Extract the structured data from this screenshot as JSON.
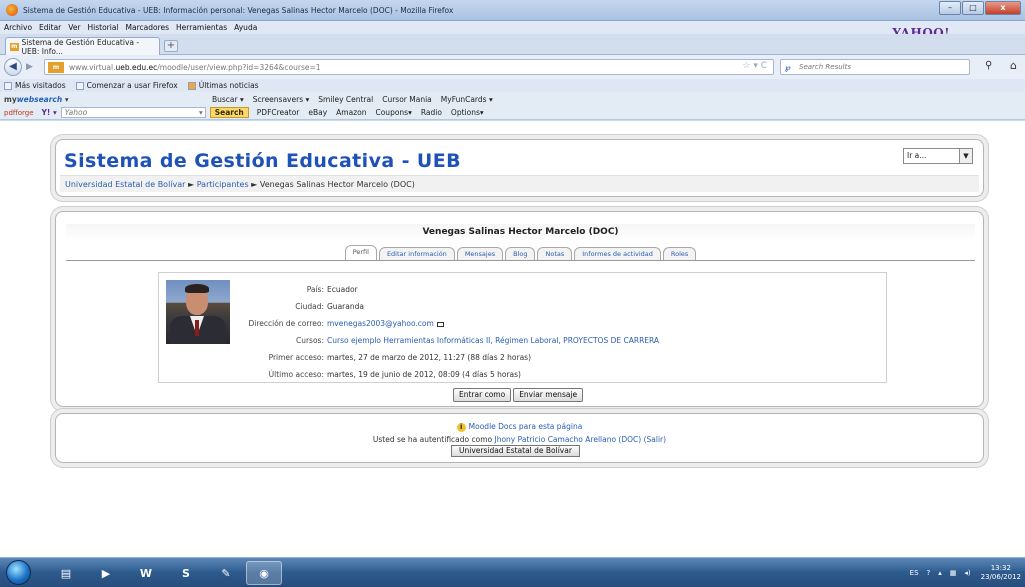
{
  "window": {
    "title": "Sistema de Gestión Educativa - UEB: Información personal: Venegas Salinas Hector Marcelo (DOC) - Mozilla Firefox",
    "minimize": "–",
    "maximize": "□",
    "close": "x"
  },
  "menu": [
    "Archivo",
    "Editar",
    "Ver",
    "Historial",
    "Marcadores",
    "Herramientas",
    "Ayuda"
  ],
  "yahoo_logo": "YAHOO!",
  "tab": {
    "label": "Sistema de Gestión Educativa - UEB: Info...",
    "new": "+"
  },
  "url": {
    "prefix": "www.virtual.",
    "domain": "ueb.edu.ec",
    "path": "/moodle/user/view.php?id=3264&course=1"
  },
  "search": {
    "placeholder": "Search Results"
  },
  "bookmarks": [
    "Más visitados",
    "Comenzar a usar Firefox",
    "Últimas noticias"
  ],
  "toolbar1": {
    "brand_prefix": "my",
    "brand_main": "websearch",
    "items": [
      "Buscar ▾",
      "Screensavers ▾",
      "Smiley Central",
      "Cursor Mania",
      "MyFunCards ▾"
    ]
  },
  "toolbar2": {
    "pdfforge": "pdfforge",
    "yahoo": "Y! ▾",
    "yahoo_box": "Yahoo",
    "search_btn": "Search",
    "items": [
      "PDFCreator",
      "eBay",
      "Amazon",
      "Coupons▾",
      "Radio",
      "Options▾"
    ]
  },
  "site": {
    "title": "Sistema de Gestión Educativa - UEB",
    "jump": "Ir a...",
    "breadcrumb": {
      "home": "Universidad Estatal de Bolívar",
      "sep": "►",
      "participants": "Participantes",
      "current": "Venegas Salinas Hector Marcelo (DOC)"
    }
  },
  "profile": {
    "name": "Venegas Salinas Hector Marcelo (DOC)",
    "tabs": [
      "Perfil",
      "Editar información",
      "Mensajes",
      "Blog",
      "Notas",
      "Informes de actividad",
      "Roles"
    ],
    "fields": {
      "country_label": "País:",
      "country": "Ecuador",
      "city_label": "Ciudad:",
      "city": "Guaranda",
      "email_label": "Dirección de correo:",
      "email": "mvenegas2003@yahoo.com",
      "courses_label": "Cursos:",
      "courses": "Curso ejemplo Herramientas Informáticas II, Régimen Laboral, PROYECTOS DE CARRERA",
      "first_label": "Primer acceso:",
      "first": "martes, 27 de marzo de 2012, 11:27  (88 días 2 horas)",
      "last_label": "Último acceso:",
      "last": "martes, 19 de junio de 2012, 08:09  (4 días 5 horas)"
    },
    "buttons": {
      "login_as": "Entrar como",
      "send_message": "Enviar mensaje"
    }
  },
  "footer": {
    "docs": "Moodle Docs para esta página",
    "login_prefix": "Usted se ha autentificado como",
    "user": "Jhony Patricio Camacho Arellano (DOC)",
    "logout": "(Salir)",
    "home_button": "Universidad Estatal de Bolívar"
  },
  "taskbar": {
    "lang": "ES",
    "time": "13:32",
    "date": "23/06/2012"
  }
}
